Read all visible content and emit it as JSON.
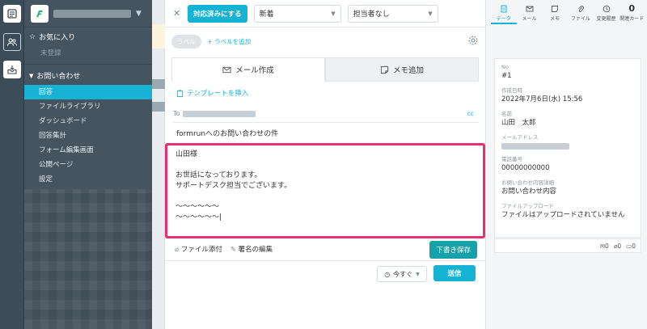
{
  "sidebar": {
    "favorites_label": "お気に入り",
    "favorites_empty": "未登録",
    "inquiries_label": "お問い合わせ",
    "items": [
      {
        "label": "回答",
        "active": true
      },
      {
        "label": "ファイルライブラリ"
      },
      {
        "label": "ダッシュボード"
      },
      {
        "label": "回答集計"
      },
      {
        "label": "フォーム編集画面"
      },
      {
        "label": "公開ページ"
      },
      {
        "label": "設定"
      }
    ]
  },
  "topbar": {
    "resolve_button": "対応済みにする",
    "status_select": "新着",
    "assignee_select": "担当者なし"
  },
  "labels": {
    "label_pill": "ラベル",
    "add_label": "+ ラベルを追加"
  },
  "tabs": {
    "compose": "メール作成",
    "memo": "メモ追加"
  },
  "compose": {
    "template_link": "テンプレートを挿入",
    "to_label": "To",
    "cc_label": "cc",
    "subject": "formrunへのお問い合わせの件",
    "body": "山田様\n\nお世話になっております。\nサポートデスク担当でございます。\n\n〜〜〜〜〜〜\n〜〜〜〜〜〜|",
    "attach_label": "ファイル添付",
    "signature_label": "署名の編集",
    "draft_button": "下書き保存",
    "schedule_select": "今すぐ",
    "send_button": "送信"
  },
  "right_panel": {
    "tabs": [
      {
        "label": "データ",
        "icon": "document-icon",
        "active": true
      },
      {
        "label": "メール",
        "icon": "mail-icon"
      },
      {
        "label": "メモ",
        "icon": "memo-icon"
      },
      {
        "label": "ファイル",
        "icon": "paperclip-icon"
      },
      {
        "label": "変更履歴",
        "icon": "clock-icon"
      },
      {
        "label": "関連カード",
        "count": "0"
      }
    ],
    "fields": {
      "no_key": "No",
      "no_value": "#1",
      "date_key": "作成日時",
      "date_value": "2022年7月6日(水) 15:56",
      "name_key": "名前",
      "name_value": "山田　太郎",
      "email_key": "メールアドレス",
      "phone_key": "電話番号",
      "phone_value": "00000000000",
      "content_key": "お問い合わせ内容詳細",
      "content_value": "お問い合わせ内容",
      "upload_key": "ファイルアップロード",
      "upload_value": "ファイルはアップロードされていません"
    },
    "counts": {
      "mail": "0",
      "file": "0",
      "memo": "0"
    }
  },
  "colors": {
    "accent": "#16b3d4",
    "highlight_border": "#e62f72",
    "sidebar_bg": "#45545f",
    "draft_button": "#17a2a9"
  }
}
